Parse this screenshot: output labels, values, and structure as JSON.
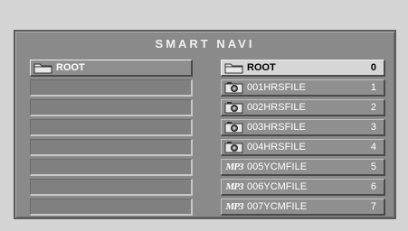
{
  "window": {
    "title": "SMART NAVI"
  },
  "left_panel": {
    "items": [
      {
        "label": "ROOT",
        "icon": "folder-icon"
      }
    ],
    "empty_slots": 7
  },
  "right_panel": {
    "items": [
      {
        "label": "ROOT",
        "number": "0",
        "icon": "folder-icon"
      },
      {
        "label": "001HRSFILE",
        "number": "1",
        "icon": "camera-icon"
      },
      {
        "label": "002HRSFILE",
        "number": "2",
        "icon": "camera-icon"
      },
      {
        "label": "003HRSFILE",
        "number": "3",
        "icon": "camera-icon"
      },
      {
        "label": "004HRSFILE",
        "number": "4",
        "icon": "camera-icon"
      },
      {
        "label": "005YCMFILE",
        "number": "5",
        "icon": "mp3-icon",
        "icon_text": "MP3"
      },
      {
        "label": "006YCMFILE",
        "number": "6",
        "icon": "mp3-icon",
        "icon_text": "MP3"
      },
      {
        "label": "007YCMFILE",
        "number": "7",
        "icon": "mp3-icon",
        "icon_text": "MP3"
      }
    ]
  }
}
